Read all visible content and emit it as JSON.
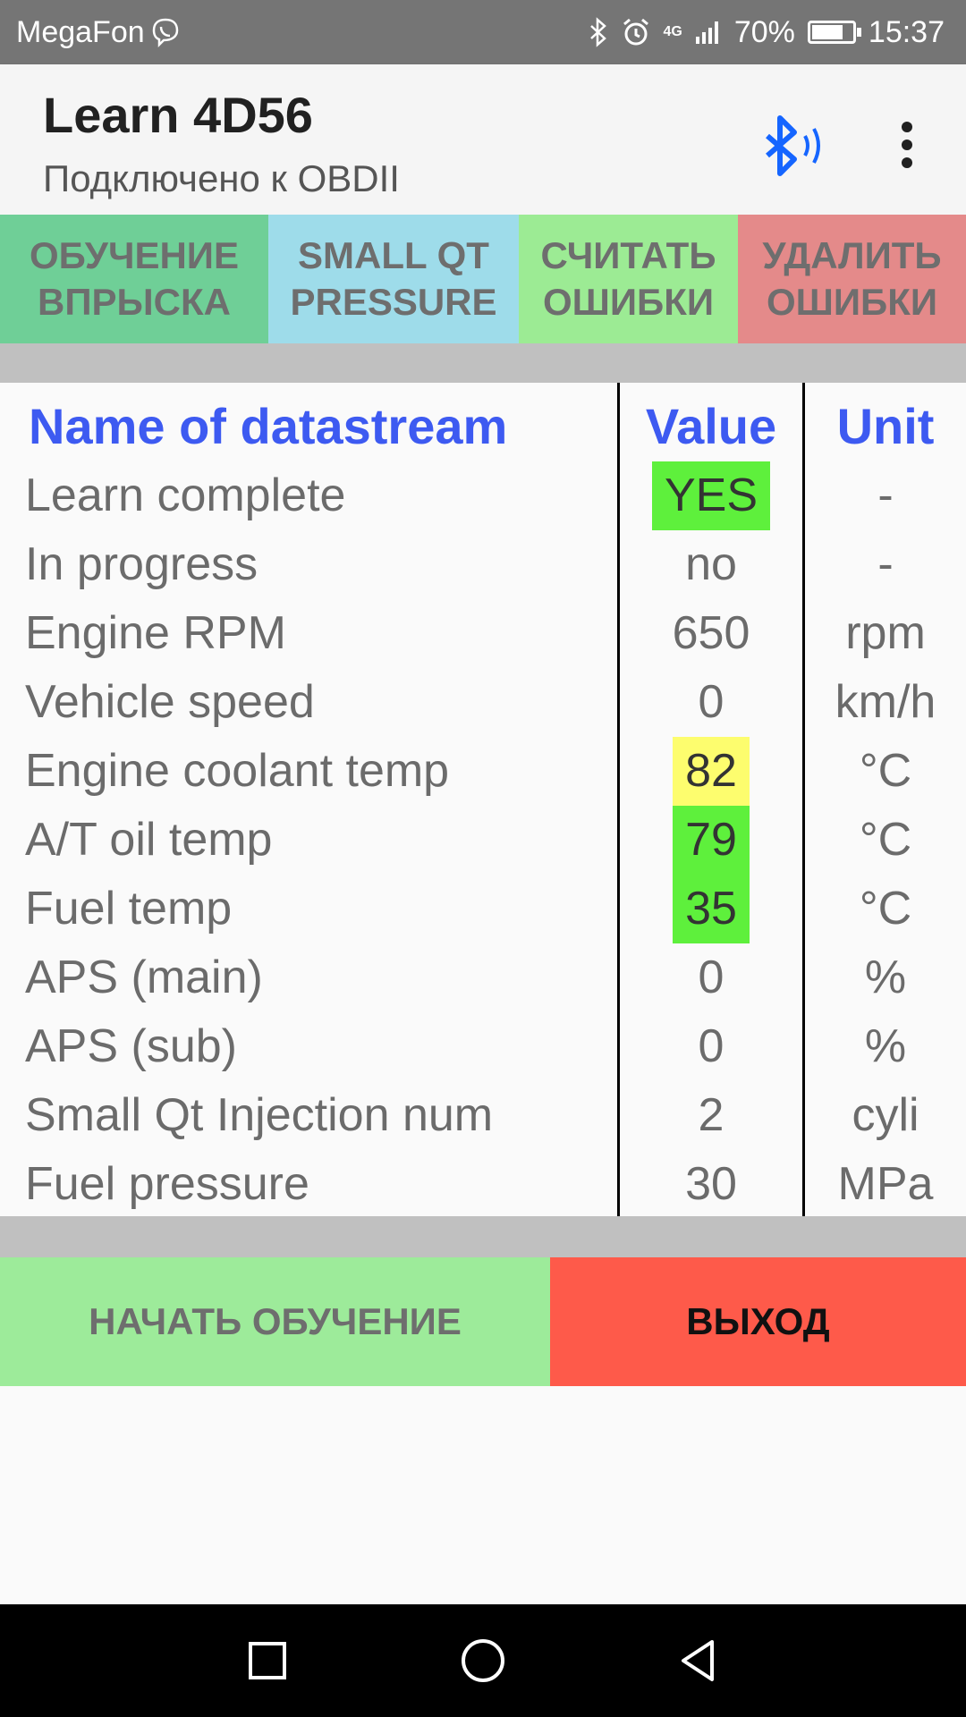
{
  "status_bar": {
    "carrier": "MegaFon",
    "network": "4G",
    "battery": "70%",
    "time": "15:37"
  },
  "app_bar": {
    "title": "Learn 4D56",
    "subtitle": "Подключено к OBDII",
    "bluetooth_color": "#1565ff"
  },
  "toolbar": {
    "buttons": [
      {
        "label": "ОБУЧЕНИЕ\nВПРЫСКА",
        "color": "#6fcf97"
      },
      {
        "label": "SMALL QT\nPRESSURE",
        "color": "#9edcea"
      },
      {
        "label": "СЧИТАТЬ\nОШИБКИ",
        "color": "#9ceb94"
      },
      {
        "label": "УДАЛИТЬ\nОШИБКИ",
        "color": "#e48a8a"
      }
    ]
  },
  "table": {
    "headers": {
      "name": "Name of datastream",
      "value": "Value",
      "unit": "Unit"
    },
    "header_color": "#3d5af1",
    "rows": [
      {
        "name": "Learn complete",
        "value": "YES",
        "unit": "-",
        "highlight": "#5ef03c"
      },
      {
        "name": "In progress",
        "value": "no",
        "unit": "-",
        "highlight": ""
      },
      {
        "name": "Engine RPM",
        "value": "650",
        "unit": "rpm",
        "highlight": ""
      },
      {
        "name": "Vehicle speed",
        "value": "0",
        "unit": "km/h",
        "highlight": ""
      },
      {
        "name": "Engine coolant temp",
        "value": "82",
        "unit": "°C",
        "highlight": "#fdfd6e"
      },
      {
        "name": "A/T oil temp",
        "value": "79",
        "unit": "°C",
        "highlight": "#5ef03c"
      },
      {
        "name": "Fuel temp",
        "value": "35",
        "unit": "°C",
        "highlight": "#5ef03c"
      },
      {
        "name": "APS (main)",
        "value": "0",
        "unit": "%",
        "highlight": ""
      },
      {
        "name": "APS (sub)",
        "value": "0",
        "unit": "%",
        "highlight": ""
      },
      {
        "name": "Small Qt Injection num",
        "value": "2",
        "unit": "cyli",
        "highlight": ""
      },
      {
        "name": "Fuel pressure",
        "value": "30",
        "unit": "MPa",
        "highlight": ""
      }
    ]
  },
  "bottom": {
    "start_label": "НАЧАТЬ ОБУЧЕНИЕ",
    "start_color": "#9deb9a",
    "exit_label": "ВЫХОД",
    "exit_color": "#fe5a4a"
  },
  "nav_bar": {
    "icons": [
      "recents-square-icon",
      "home-circle-icon",
      "back-triangle-icon"
    ]
  }
}
